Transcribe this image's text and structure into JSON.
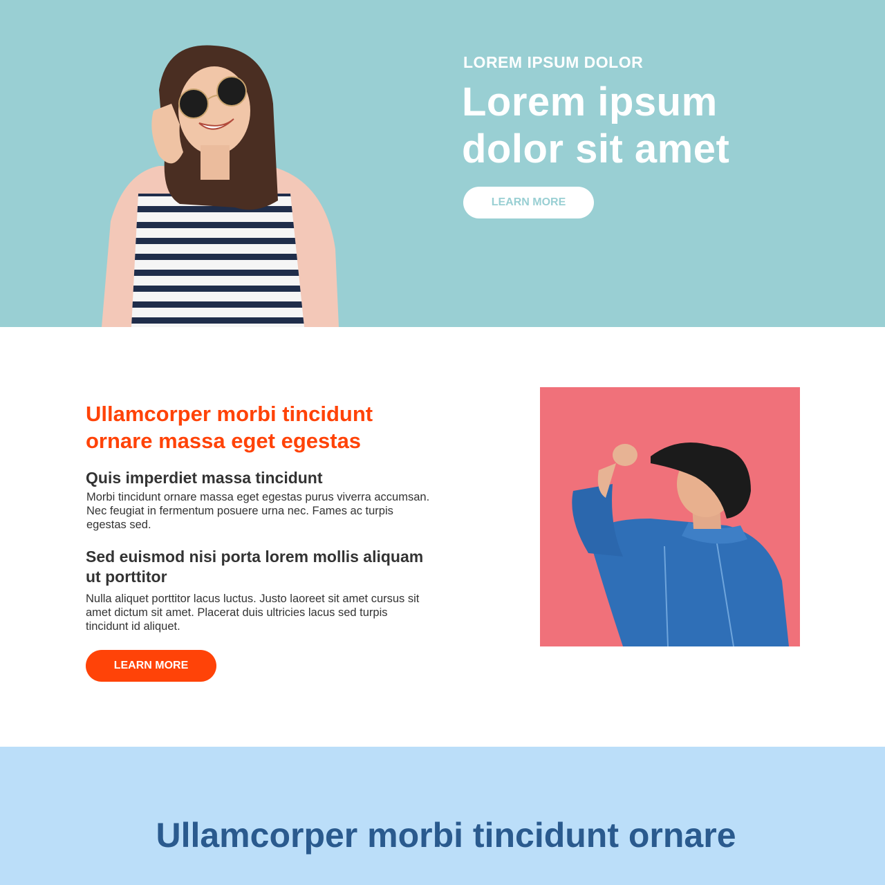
{
  "hero": {
    "eyebrow": "LOREM IPSUM DOLOR",
    "title": "Lorem ipsum dolor sit amet",
    "button_label": "LEARN MORE",
    "background_color": "#99cfd3",
    "photo": "woman-sunglasses-striped-shirt-photo"
  },
  "feature": {
    "heading": "Ullamcorper morbi tincidunt ornare massa eget egestas",
    "heading_color": "#ff4308",
    "sections": [
      {
        "title": "Quis imperdiet massa tincidunt",
        "text": "Morbi tincidunt ornare massa eget egestas purus viverra accumsan. Nec feugiat in fermentum posuere urna nec. Fames ac turpis egestas sed."
      },
      {
        "title": "Sed euismod nisi porta lorem mollis aliquam ut porttitor",
        "text": "Nulla aliquet porttitor lacus luctus. Justo laoreet sit amet cursus sit amet dictum sit amet. Placerat duis ultricies lacus sed turpis tincidunt id aliquet."
      }
    ],
    "button_label": "LEARN MORE",
    "photo": "person-denim-jacket-pink-background-photo",
    "photo_background": "#f0717a"
  },
  "bottom": {
    "heading": "Ullamcorper morbi tincidunt ornare",
    "background_color": "#bbdef9",
    "heading_color": "#2a5a8e"
  }
}
